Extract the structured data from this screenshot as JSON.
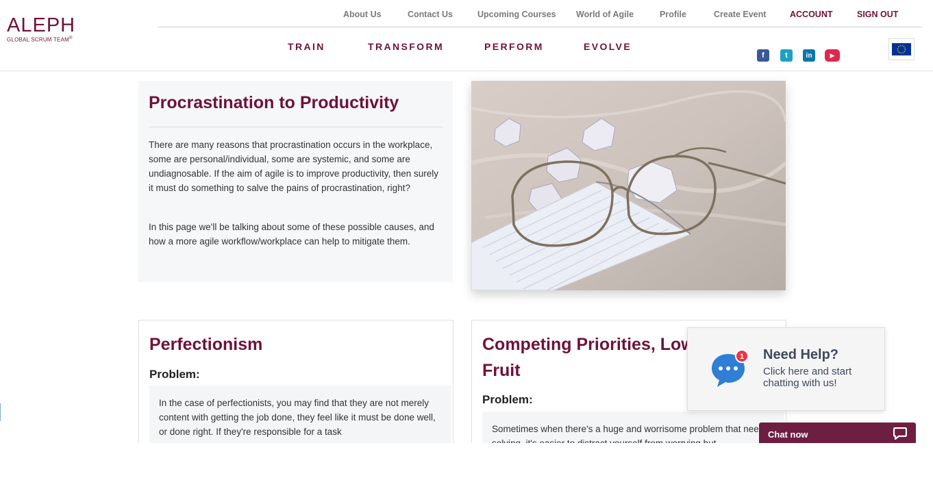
{
  "logo": {
    "main": "ALEPH",
    "sub": "GLOBAL SCRUM TEAM",
    "mark": "®"
  },
  "top_nav": [
    "About Us",
    "Contact Us",
    "Upcoming Courses",
    "World of Agile",
    "Profile",
    "Create Event",
    "ACCOUNT",
    "SIGN OUT"
  ],
  "main_nav": [
    "TRAIN",
    "TRANSFORM",
    "PERFORM",
    "EVOLVE"
  ],
  "social": {
    "facebook": "f",
    "twitter": "t",
    "linkedin": "in",
    "youtube": "▶"
  },
  "intro": {
    "title": "Procrastination to Productivity",
    "p1": "There are many reasons that procrastination occurs in the workplace, some are personal/individual, some are systemic, and some are undiagnosable. If the aim of agile is to improve productivity, then surely it must do something to salve the pains of procrastination, right?",
    "p2": "In this page we'll be talking about some of these possible causes, and how a more agile workflow/workplace can help to mitigate them."
  },
  "cards": [
    {
      "title": "Perfectionism",
      "subtitle": "Problem:",
      "text": "In the case of perfectionists, you may find that they are not merely content with getting the job done, they feel like it must be done well, or done right. If they're responsible for a task"
    },
    {
      "title": "Competing Priorities, Low Hanging Fruit",
      "subtitle": "Problem:",
      "text": "Sometimes when there's a huge and worrisome problem that needs solving, it's easier to distract yourself from worrying but"
    }
  ],
  "help_widget": {
    "badge": "1",
    "title": "Need Help?",
    "text": "Click here and start chatting with us!"
  },
  "chat_bar": {
    "label": "Chat now"
  },
  "colors": {
    "brand": "#6e1239",
    "chat": "#6e1e40",
    "facebook": "#3b5998",
    "twitter": "#1da1c2",
    "linkedin": "#0e76a8",
    "youtube": "#e0284a",
    "chat_icon": "#2f7fd6"
  },
  "icons": [
    "facebook-icon",
    "twitter-icon",
    "linkedin-icon",
    "youtube-icon",
    "eu-flag-icon",
    "chat-bubble-icon",
    "chat-speech-icon"
  ]
}
